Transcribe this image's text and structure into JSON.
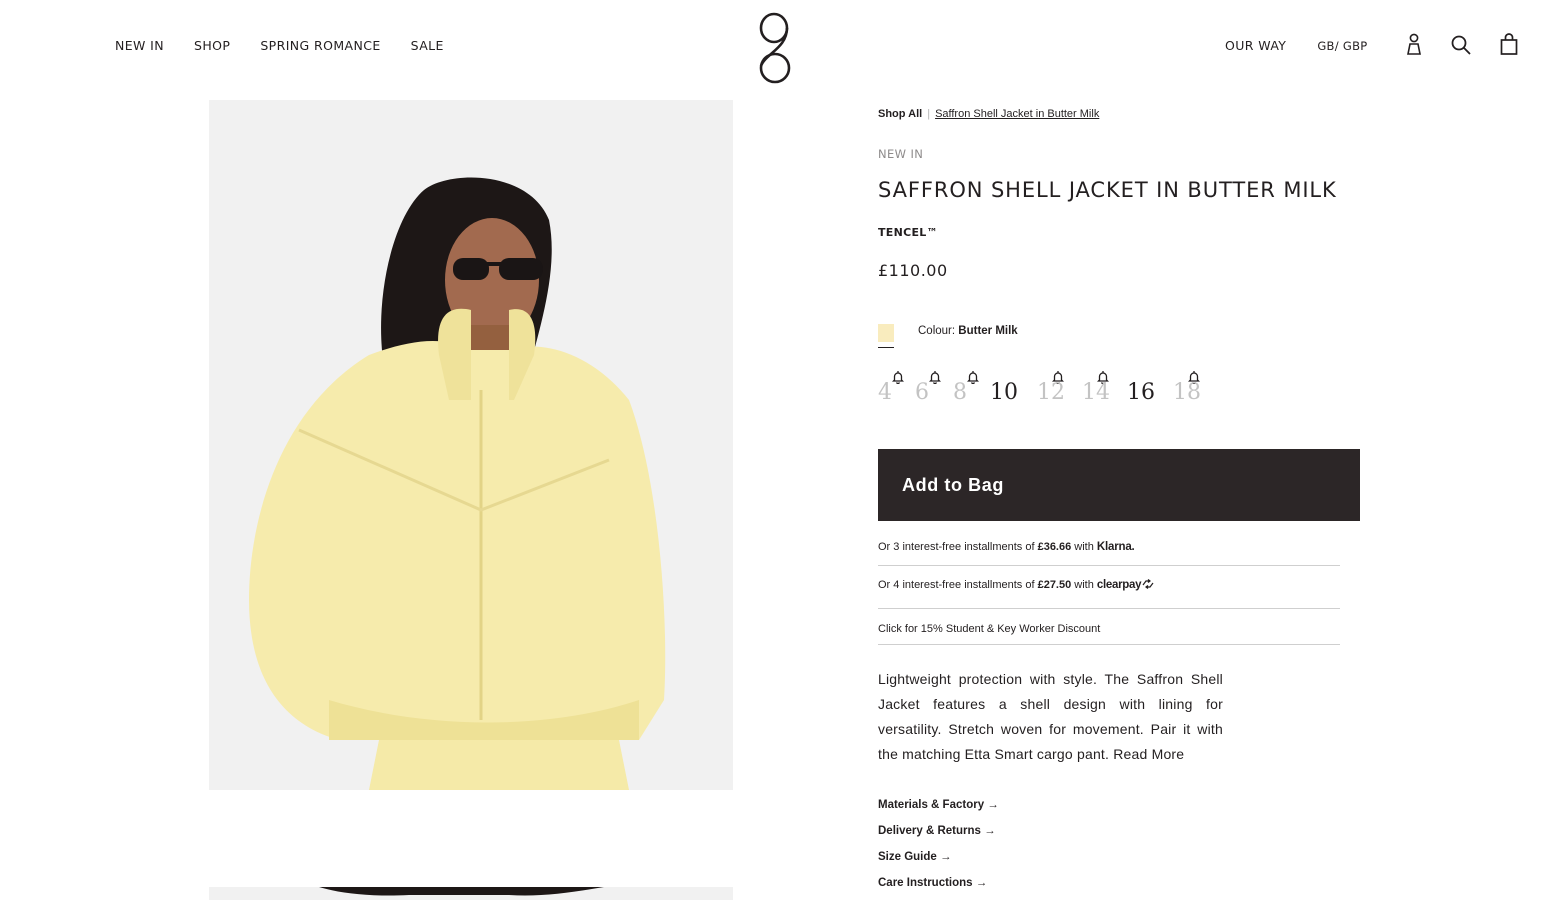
{
  "header": {
    "nav": [
      "NEW IN",
      "SHOP",
      "SPRING ROMANCE",
      "SALE"
    ],
    "our_way": "OUR WAY",
    "currency": "GB/ GBP"
  },
  "breadcrumb": {
    "home": "Shop All",
    "current": "Saffron Shell Jacket in Butter Milk"
  },
  "product": {
    "collection": "NEW IN",
    "title": "SAFFRON SHELL JACKET IN BUTTER MILK",
    "material": "TENCEL™",
    "price": "£110.00",
    "colour_label": "Colour:",
    "colour_value": "Butter Milk",
    "swatch_color": "#f9ecbe",
    "sizes": [
      {
        "label": "4",
        "available": false
      },
      {
        "label": "6",
        "available": false
      },
      {
        "label": "8",
        "available": false
      },
      {
        "label": "10",
        "available": true
      },
      {
        "label": "12",
        "available": false
      },
      {
        "label": "14",
        "available": false
      },
      {
        "label": "16",
        "available": true
      },
      {
        "label": "18",
        "available": false
      }
    ],
    "add_to_bag": "Add to Bag"
  },
  "payments": {
    "klarna_prefix": "Or 3 interest-free installments of",
    "klarna_amount": "£36.66",
    "klarna_with": "with",
    "klarna_brand": "Klarna.",
    "clearpay_prefix": "Or 4 interest-free installments of",
    "clearpay_amount": "£27.50",
    "clearpay_with": "with",
    "clearpay_brand": "clearpay",
    "discount": "Click for 15% Student & Key Worker Discount"
  },
  "description": {
    "text": "Lightweight protection with style. The Saffron Shell Jacket features a shell design with lining for versatility. Stretch woven for movement. Pair it with the matching  Etta Smart cargo pant.",
    "read_more": "Read More"
  },
  "links": [
    "Materials & Factory →",
    "Delivery & Returns →",
    "Size Guide →",
    "Care Instructions →"
  ],
  "colors": {
    "ink": "#231f20",
    "button_bg": "#2c2627",
    "muted": "#8e8b8b",
    "oos_size": "#c3c3c3"
  }
}
